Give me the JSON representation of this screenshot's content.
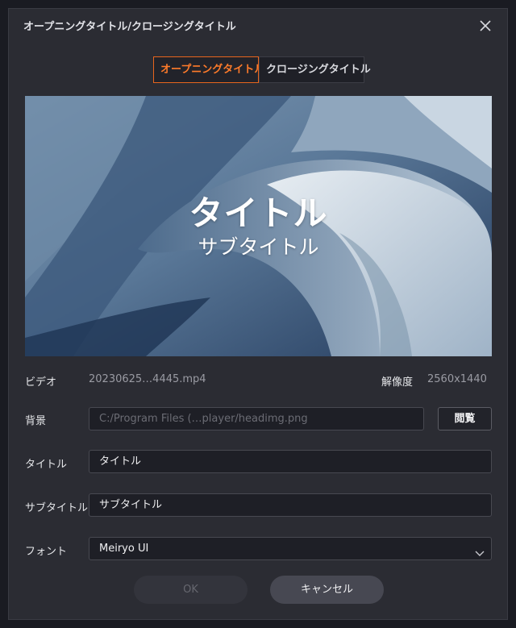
{
  "window": {
    "title": "オープニングタイトル/クロージングタイトル"
  },
  "tabs": [
    {
      "label": "オープニングタイトル",
      "active": true
    },
    {
      "label": "クロージングタイトル",
      "active": false
    }
  ],
  "preview": {
    "title": "タイトル",
    "subtitle": "サブタイトル"
  },
  "info": {
    "video_label": "ビデオ",
    "video_value": "20230625…4445.mp4",
    "resolution_label": "解像度",
    "resolution_value": "2560x1440"
  },
  "form": {
    "background_label": "背景",
    "background_value": "C:/Program Files (…player/headimg.png",
    "browse_label": "閲覧",
    "title_label": "タイトル",
    "title_value": "タイトル",
    "subtitle_label": "サブタイトル",
    "subtitle_value": "サブタイトル",
    "font_label": "フォント",
    "font_value": "Meiryo UI"
  },
  "buttons": {
    "ok": "OK",
    "cancel": "キャンセル"
  },
  "colors": {
    "accent": "#ff7b2a",
    "window_bg": "#2b2c33",
    "field_bg": "#1e1f26"
  },
  "icons": {
    "close": "close-icon",
    "dropdown": "chevron-down-icon"
  }
}
